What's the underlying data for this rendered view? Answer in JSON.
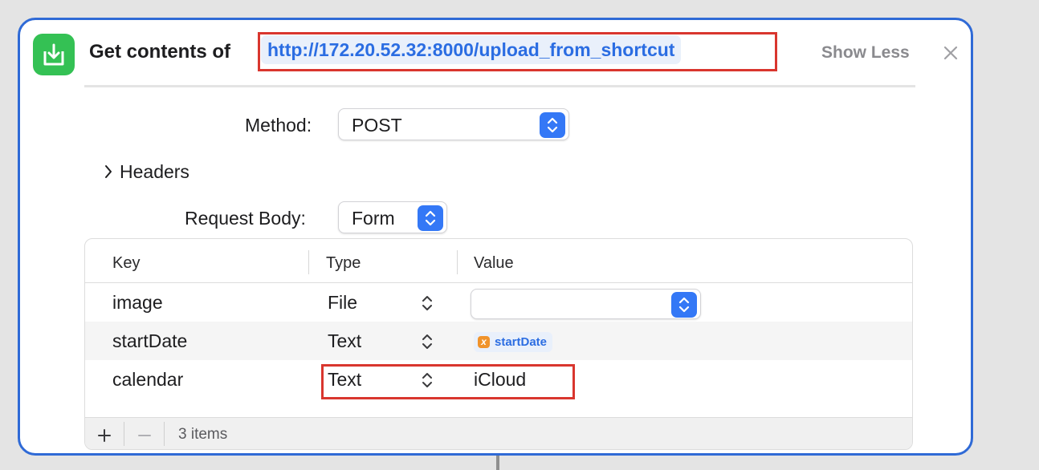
{
  "action": {
    "title": "Get contents of",
    "url": "http://172.20.52.32:8000/upload_from_shortcut",
    "show_less": "Show Less",
    "icon": "download-tray-icon",
    "icon_color": "#34c154",
    "accent": "#2f6ad6"
  },
  "method": {
    "label": "Method:",
    "value": "POST"
  },
  "headers": {
    "label": "Headers"
  },
  "request_body": {
    "label": "Request Body:",
    "value": "Form"
  },
  "table": {
    "columns": [
      "Key",
      "Type",
      "Value"
    ],
    "rows": [
      {
        "key": "image",
        "type": "File",
        "value": ""
      },
      {
        "key": "startDate",
        "type": "Text",
        "value": "startDate"
      },
      {
        "key": "calendar",
        "type": "Text",
        "value": "iCloud"
      }
    ],
    "item_count": "3 items"
  },
  "highlight_color": "#d9362e"
}
